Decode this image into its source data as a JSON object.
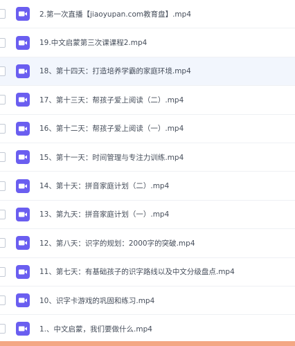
{
  "file_list": {
    "items": [
      {
        "name": "2.第一次直播【jiaoyupan.com教育盘】.mp4",
        "highlighted": false
      },
      {
        "name": "19.中文启蒙第三次课课程2.mp4",
        "highlighted": false
      },
      {
        "name": "18、第十四天：打造培养学霸的家庭环境.mp4",
        "highlighted": true
      },
      {
        "name": "17、第十三天：帮孩子爱上阅读（二）.mp4",
        "highlighted": false
      },
      {
        "name": "16、第十二天：帮孩子爱上阅读（一）.mp4",
        "highlighted": false
      },
      {
        "name": "15、第十一天：时间管理与专注力训练.mp4",
        "highlighted": false
      },
      {
        "name": "14、第十天：拼音家庭计划（二）.mp4",
        "highlighted": false
      },
      {
        "name": "13、第九天：拼音家庭计划（一）.mp4",
        "highlighted": false
      },
      {
        "name": "12、第八天：识字的规划：2000字的突破.mp4",
        "highlighted": false
      },
      {
        "name": "11、第七天：有基础孩子的识字路线以及中文分级盘点.mp4",
        "highlighted": false
      },
      {
        "name": "10、识字卡游戏的巩固和练习.mp4",
        "highlighted": false
      },
      {
        "name": "1.、中文启蒙，我们要做什么.mp4",
        "highlighted": false
      }
    ]
  },
  "colors": {
    "video_icon": "#6a5ef0",
    "row_highlight": "#f2f6fd",
    "bottom_bar": "#f3a784",
    "text": "#454d5a"
  },
  "icon": "video-file-icon"
}
